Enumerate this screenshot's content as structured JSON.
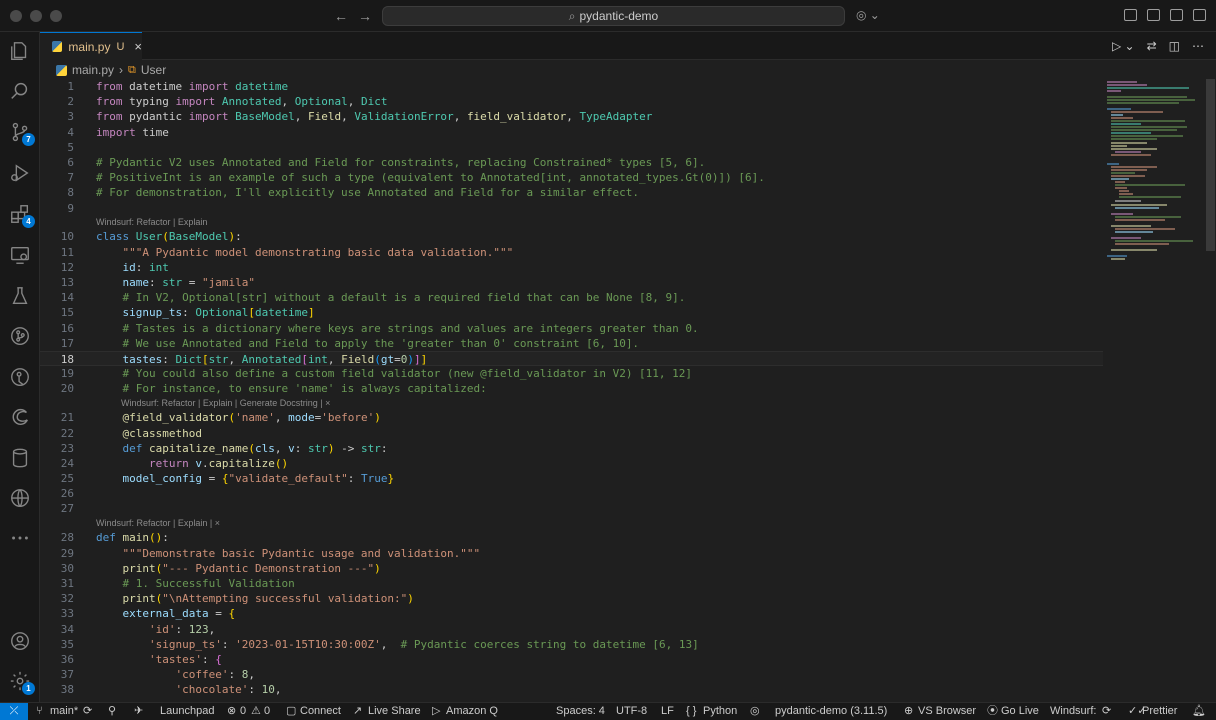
{
  "window": {
    "command_center": "pydantic-demo"
  },
  "activity_badges": {
    "source_control": "7",
    "extensions": "4",
    "accounts": "1"
  },
  "tab": {
    "label": "main.py",
    "modified": "U",
    "close": "×"
  },
  "breadcrumb": {
    "file": "main.py",
    "symbol": "User"
  },
  "code_lens": {
    "l1": "Windsurf: Refactor | Explain",
    "l2": "Windsurf: Refactor | Explain | Generate Docstring | ×",
    "l3": "Windsurf: Refactor | Explain | ×"
  },
  "status": {
    "branch": "main*",
    "launchpad": "Launchpad",
    "problems": "0",
    "warnings": "0",
    "connect": "Connect",
    "live_share": "Live Share",
    "amazon_q": "Amazon Q",
    "spaces": "Spaces: 4",
    "encoding": "UTF-8",
    "eol": "LF",
    "language": "Python",
    "interpreter": "pydantic-demo (3.11.5)",
    "vs_browser": "VS Browser",
    "go_live": "Go Live",
    "windsurf": "Windsurf:",
    "prettier": "Prettier"
  },
  "colors": {
    "accent": "#0078d4",
    "editor_bg": "#1f1f1f",
    "comment": "#6a9955",
    "string": "#ce9178",
    "keyword": "#569cd6"
  }
}
